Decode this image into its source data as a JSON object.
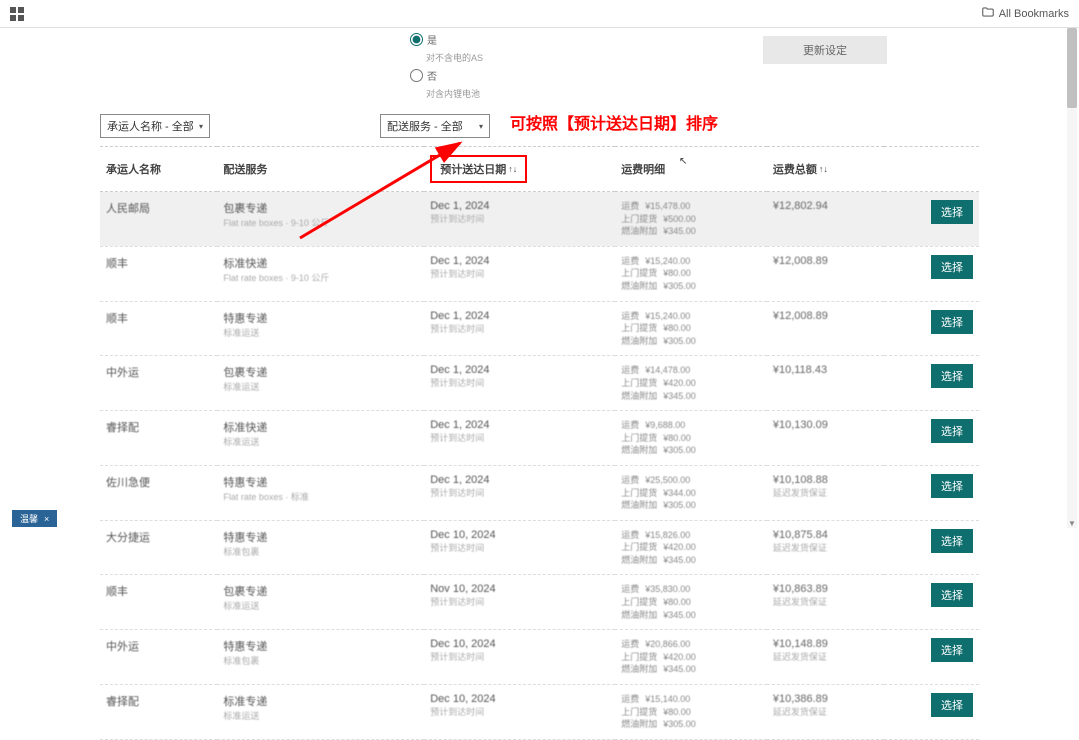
{
  "topbar": {
    "bookmarks_label": "All Bookmarks"
  },
  "radio_section": {
    "opt1_label": "是",
    "opt1_sub": "对不含电的AS",
    "opt2_label": "否",
    "opt2_sub": "对含内锂电池",
    "refresh_label": "更新设定"
  },
  "filters": {
    "carrier_select": "承运人名称 - 全部",
    "service_select": "配送服务 - 全部"
  },
  "annotation": "可按照【预计送达日期】排序",
  "table": {
    "headers": {
      "carrier": "承运人名称",
      "service": "配送服务",
      "eta": "预计送达日期",
      "fee_detail": "运费明细",
      "total": "运费总额",
      "sort_asc": "↑↓"
    },
    "fee_labels": {
      "base": "运费",
      "pickup": "上门提货",
      "fuel": "燃油附加"
    },
    "rows": [
      {
        "carrier": "人民邮局",
        "service_main": "包裹专递",
        "service_sub": "Flat rate boxes · 9-10 公斤",
        "eta_main": "Dec 1, 2024",
        "eta_sub": "预计到达时间",
        "fee_base": "¥15,478.00",
        "fee_pickup": "¥500.00",
        "fee_fuel": "¥345.00",
        "total_main": "¥12,802.94",
        "total_sub": "",
        "hover": true
      },
      {
        "carrier": "顺丰",
        "service_main": "标准快递",
        "service_sub": "Flat rate boxes · 9-10 公斤",
        "eta_main": "Dec 1, 2024",
        "eta_sub": "预计到达时间",
        "fee_base": "¥15,240.00",
        "fee_pickup": "¥80.00",
        "fee_fuel": "¥305.00",
        "total_main": "¥12,008.89",
        "total_sub": ""
      },
      {
        "carrier": "顺丰",
        "service_main": "特惠专递",
        "service_sub": "标准运送",
        "eta_main": "Dec 1, 2024",
        "eta_sub": "预计到达时间",
        "fee_base": "¥15,240.00",
        "fee_pickup": "¥80.00",
        "fee_fuel": "¥305.00",
        "total_main": "¥12,008.89",
        "total_sub": ""
      },
      {
        "carrier": "中外运",
        "service_main": "包裹专递",
        "service_sub": "标准运送",
        "eta_main": "Dec 1, 2024",
        "eta_sub": "预计到达时间",
        "fee_base": "¥14,478.00",
        "fee_pickup": "¥420.00",
        "fee_fuel": "¥345.00",
        "total_main": "¥10,118.43",
        "total_sub": ""
      },
      {
        "carrier": "睿择配",
        "service_main": "标准快递",
        "service_sub": "标准运送",
        "eta_main": "Dec 1, 2024",
        "eta_sub": "预计到达时间",
        "fee_base": "¥9,688.00",
        "fee_pickup": "¥80.00",
        "fee_fuel": "¥305.00",
        "total_main": "¥10,130.09",
        "total_sub": ""
      },
      {
        "carrier": "佐川急便",
        "service_main": "特惠专递",
        "service_sub": "Flat rate boxes · 标准",
        "eta_main": "Dec 1, 2024",
        "eta_sub": "预计到达时间",
        "fee_base": "¥25,500.00",
        "fee_pickup": "¥344.00",
        "fee_fuel": "¥305.00",
        "total_main": "¥10,108.88",
        "total_sub": "延迟发货保证"
      },
      {
        "carrier": "大分捷运",
        "service_main": "特惠专递",
        "service_sub": "标准包裹",
        "eta_main": "Dec 10, 2024",
        "eta_sub": "预计到达时间",
        "fee_base": "¥15,826.00",
        "fee_pickup": "¥420.00",
        "fee_fuel": "¥345.00",
        "total_main": "¥10,875.84",
        "total_sub": "延迟发货保证"
      },
      {
        "carrier": "顺丰",
        "service_main": "包裹专递",
        "service_sub": "标准运送",
        "eta_main": "Nov 10, 2024",
        "eta_sub": "预计到达时间",
        "fee_base": "¥35,830.00",
        "fee_pickup": "¥80.00",
        "fee_fuel": "¥345.00",
        "total_main": "¥10,863.89",
        "total_sub": "延迟发货保证"
      },
      {
        "carrier": "中外运",
        "service_main": "特惠专递",
        "service_sub": "标准包裹",
        "eta_main": "Dec 10, 2024",
        "eta_sub": "预计到达时间",
        "fee_base": "¥20,866.00",
        "fee_pickup": "¥420.00",
        "fee_fuel": "¥345.00",
        "total_main": "¥10,148.89",
        "total_sub": "延迟发货保证"
      },
      {
        "carrier": "睿择配",
        "service_main": "标准专递",
        "service_sub": "标准运送",
        "eta_main": "Dec 10, 2024",
        "eta_sub": "预计到达时间",
        "fee_base": "¥15,140.00",
        "fee_pickup": "¥80.00",
        "fee_fuel": "¥305.00",
        "total_main": "¥10,386.89",
        "total_sub": "延迟发货保证"
      }
    ]
  },
  "select_button_label": "选择",
  "bottom_tab_label": "温馨"
}
